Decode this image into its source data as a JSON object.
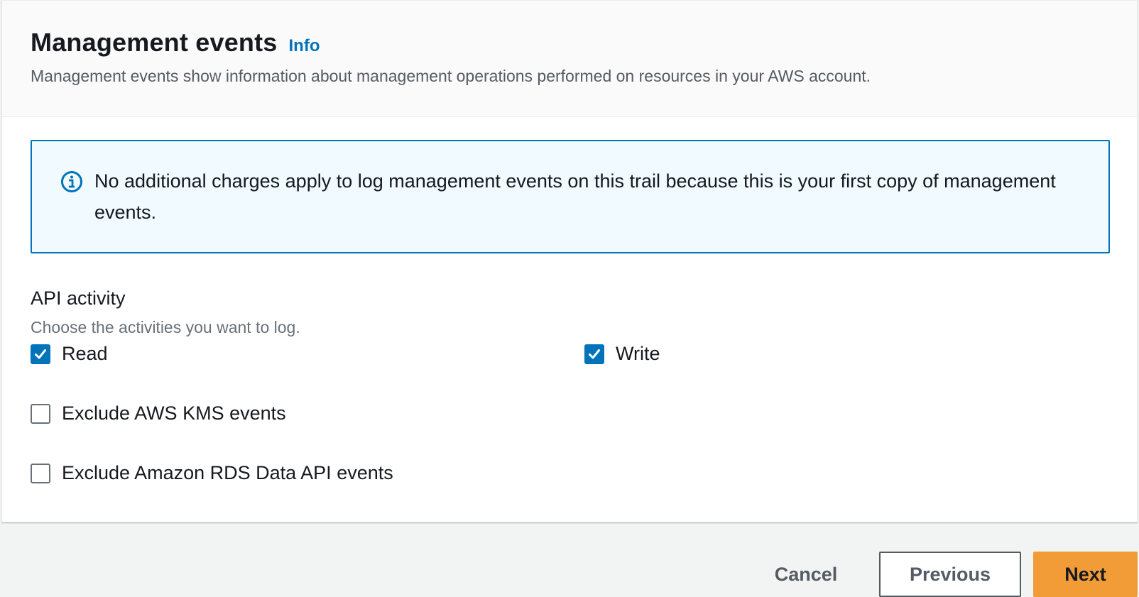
{
  "header": {
    "title": "Management events",
    "info_link": "Info",
    "description": "Management events show information about management operations performed on resources in your AWS account."
  },
  "alert": {
    "icon": "info-circle-icon",
    "message": "No additional charges apply to log management events on this trail because this is your first copy of management events."
  },
  "api_activity": {
    "label": "API activity",
    "description": "Choose the activities you want to log.",
    "options": [
      {
        "label": "Read",
        "checked": true
      },
      {
        "label": "Write",
        "checked": true
      }
    ]
  },
  "exclusions": [
    {
      "label": "Exclude AWS KMS events",
      "checked": false
    },
    {
      "label": "Exclude Amazon RDS Data API events",
      "checked": false
    }
  ],
  "footer": {
    "cancel_label": "Cancel",
    "previous_label": "Previous",
    "next_label": "Next"
  },
  "colors": {
    "accent": "#0073bb",
    "primary_button": "#f29c38",
    "alert_background": "#f1faff"
  }
}
